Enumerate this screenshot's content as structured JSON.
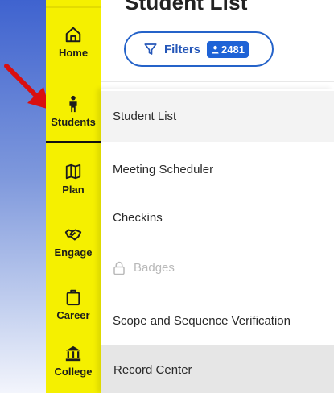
{
  "page": {
    "title": "Student List"
  },
  "filters": {
    "label": "Filters",
    "count": "2481"
  },
  "sidebar": {
    "items": [
      {
        "label": "Home",
        "icon": "home-icon"
      },
      {
        "label": "Students",
        "icon": "student-icon",
        "active": true
      },
      {
        "label": "Plan",
        "icon": "map-icon"
      },
      {
        "label": "Engage",
        "icon": "handshake-icon"
      },
      {
        "label": "Career",
        "icon": "briefcase-icon"
      },
      {
        "label": "College",
        "icon": "bank-icon"
      }
    ]
  },
  "menu": {
    "items": [
      {
        "label": "Student List"
      },
      {
        "label": "Meeting Scheduler"
      },
      {
        "label": "Checkins"
      },
      {
        "label": "Badges",
        "disabled": true,
        "icon": "lock-icon"
      },
      {
        "label": "Scope and Sequence Verification"
      },
      {
        "label": "Record Center",
        "selected": true
      }
    ]
  },
  "colors": {
    "sidebar_bg": "#f5f000",
    "accent_blue": "#1f63d6",
    "arrow_red": "#d90f0f"
  }
}
